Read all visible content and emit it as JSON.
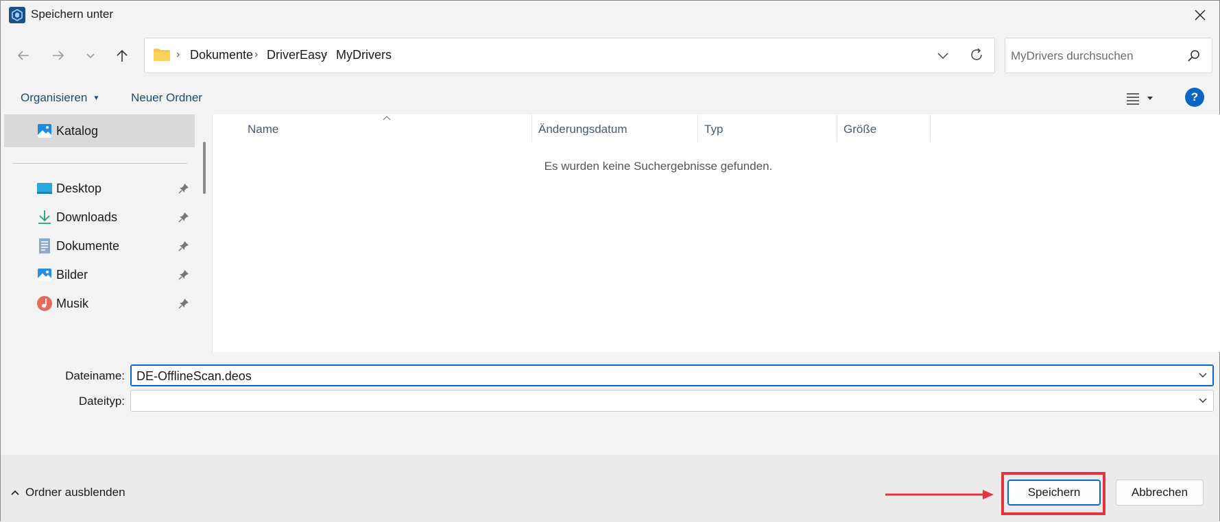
{
  "window": {
    "title": "Speichern unter"
  },
  "nav": {
    "breadcrumb": [
      "Dokumente",
      "DriverEasy",
      "MyDrivers"
    ],
    "search_placeholder": "MyDrivers durchsuchen"
  },
  "toolbar": {
    "organize_label": "Organisieren",
    "new_folder_label": "Neuer Ordner"
  },
  "sidebar": {
    "items": [
      {
        "label": "Katalog",
        "icon": "gallery-icon",
        "pinned": false,
        "selected": true
      },
      {
        "label": "Desktop",
        "icon": "desktop-icon",
        "pinned": true
      },
      {
        "label": "Downloads",
        "icon": "download-icon",
        "pinned": true
      },
      {
        "label": "Dokumente",
        "icon": "document-icon",
        "pinned": true
      },
      {
        "label": "Bilder",
        "icon": "pictures-icon",
        "pinned": true
      },
      {
        "label": "Musik",
        "icon": "music-icon",
        "pinned": true
      }
    ]
  },
  "filelist": {
    "columns": [
      "Name",
      "Änderungsdatum",
      "Typ",
      "Größe"
    ],
    "empty_message": "Es wurden keine Suchergebnisse gefunden."
  },
  "form": {
    "filename_label": "Dateiname:",
    "filename_value": "DE-OfflineScan.deos",
    "filetype_label": "Dateityp:",
    "filetype_value": ""
  },
  "footer": {
    "hide_folders_label": "Ordner ausblenden",
    "save_label": "Speichern",
    "cancel_label": "Abbrechen"
  },
  "colors": {
    "accent": "#0a66c2",
    "annotation": "#e8323c"
  }
}
